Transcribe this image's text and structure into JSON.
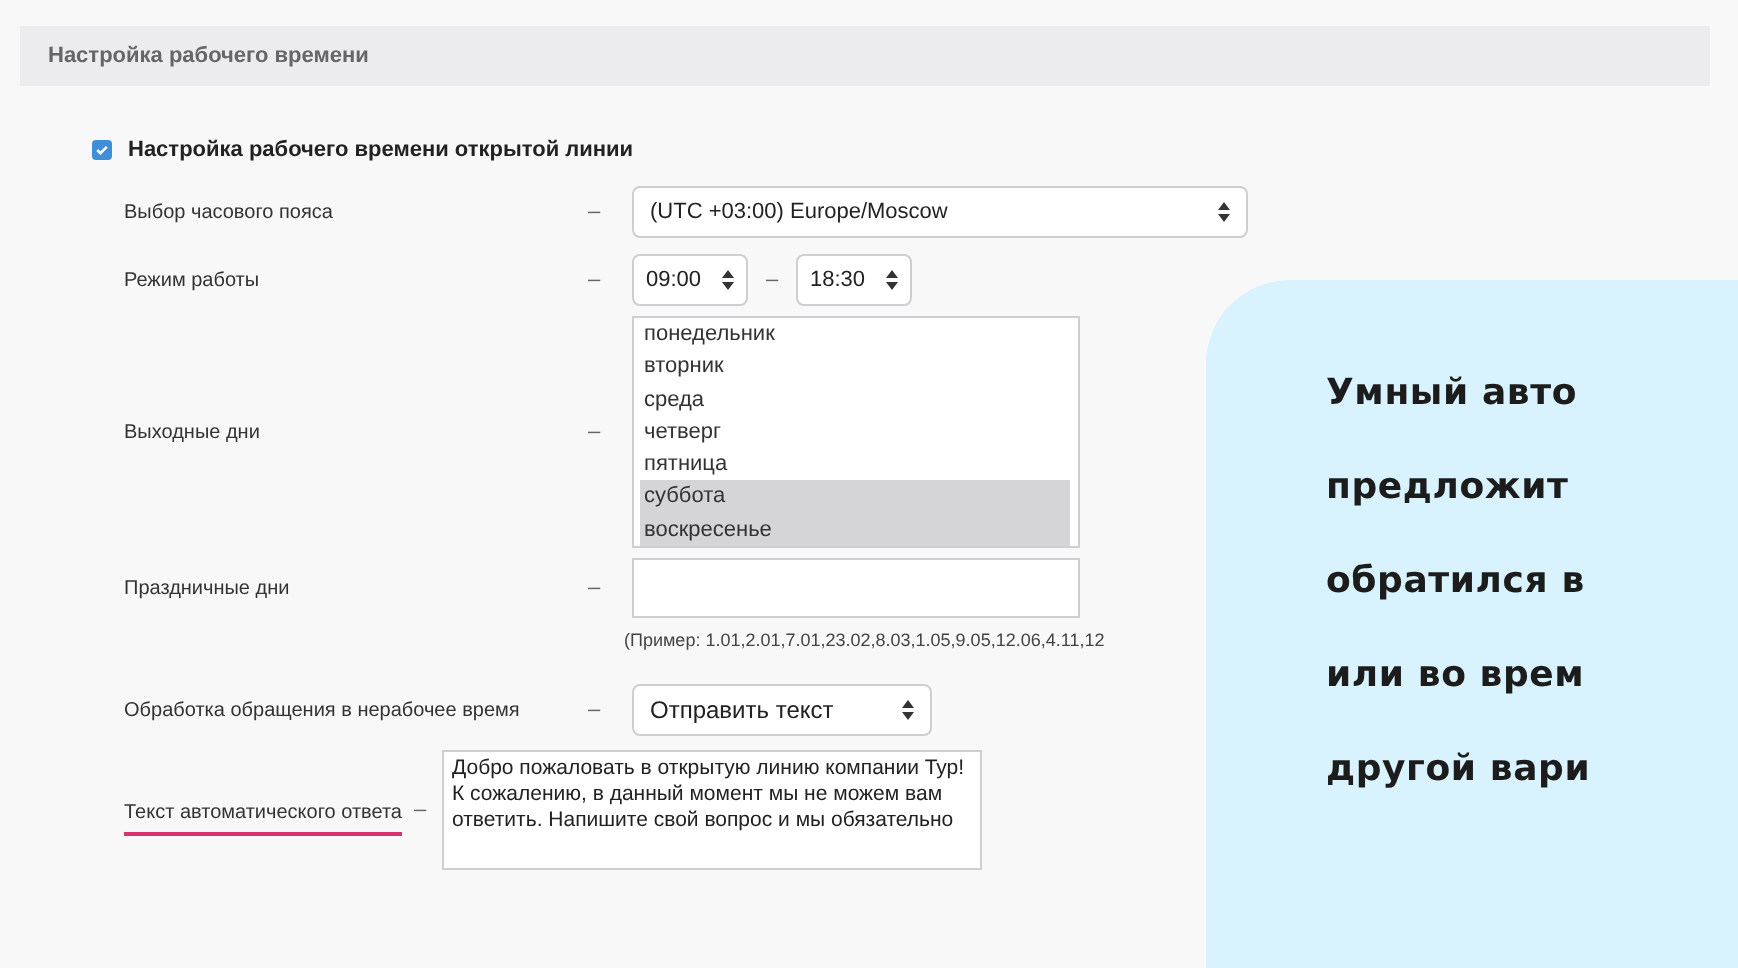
{
  "section": {
    "title": "Настройка рабочего времени"
  },
  "enable": {
    "label": "Настройка рабочего времени открытой линии",
    "checked": true
  },
  "timezone": {
    "label": "Выбор часового пояса",
    "separator": "–",
    "value": "(UTC +03:00) Europe/Moscow"
  },
  "work_hours": {
    "label": "Режим работы",
    "separator": "–",
    "from": "09:00",
    "range_separator": "–",
    "to": "18:30"
  },
  "weekends": {
    "label": "Выходные дни",
    "separator": "–",
    "days": [
      {
        "label": "понедельник",
        "selected": false
      },
      {
        "label": "вторник",
        "selected": false
      },
      {
        "label": "среда",
        "selected": false
      },
      {
        "label": "четверг",
        "selected": false
      },
      {
        "label": "пятница",
        "selected": false
      },
      {
        "label": "суббота",
        "selected": true
      },
      {
        "label": "воскресенье",
        "selected": true
      }
    ]
  },
  "holidays": {
    "label": "Праздничные дни",
    "separator": "–",
    "hint": "(Пример: 1.01,2.01,7.01,23.02,8.03,1.05,9.05,12.06,4.11,12"
  },
  "off_hours": {
    "label": "Обработка обращения в нерабочее время",
    "separator": "–",
    "value": "Отправить текст"
  },
  "auto_reply": {
    "label": "Текст автоматического ответа",
    "separator": "–",
    "highlighted": true,
    "value": "Добро пожаловать в открытую линию компании Тур! К сожалению, в данный момент мы не можем вам ответить. Напишите свой вопрос и мы обязательно"
  },
  "callout": {
    "lines": [
      "Умный авто",
      "предложит",
      "обратился в",
      "или во врем",
      "другой вари"
    ]
  }
}
